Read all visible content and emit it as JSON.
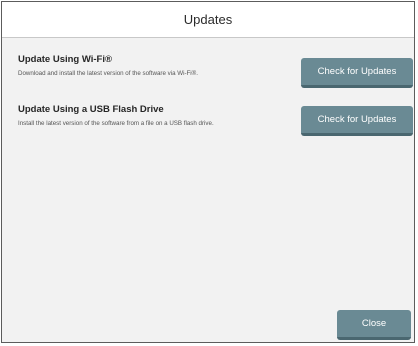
{
  "dialog": {
    "title": "Updates",
    "close_label": "Close"
  },
  "sections": [
    {
      "title": "Update Using Wi-Fi®",
      "description": "Download and install the latest version of the software via Wi-Fi®.",
      "button_label": "Check for Updates"
    },
    {
      "title": "Update Using a USB Flash Drive",
      "description": "Install the latest version of the software from a file on a USB flash drive.",
      "button_label": "Check for Updates"
    }
  ]
}
